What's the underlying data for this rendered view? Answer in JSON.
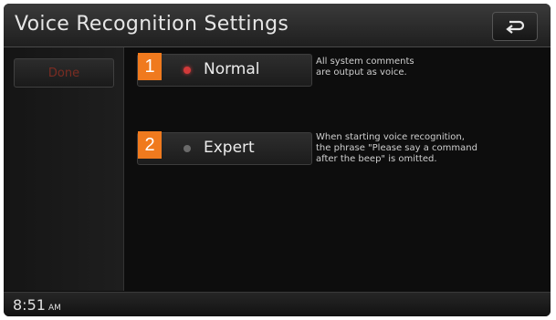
{
  "title": "Voice Recognition Settings",
  "back_icon": "back-arrow-icon",
  "sidebar": {
    "done_label": "Done"
  },
  "options": [
    {
      "badge": "1",
      "label": "Normal",
      "selected": true,
      "description_line1": "All system comments",
      "description_line2": "are output as voice."
    },
    {
      "badge": "2",
      "label": "Expert",
      "selected": false,
      "description_line1": "When starting voice recognition,",
      "description_line2": "the phrase \"Please say a command",
      "description_line3": "after the beep\" is omitted."
    }
  ],
  "status": {
    "time": "8:51",
    "ampm": "AM"
  },
  "colors": {
    "accent_badge": "#f07a1e",
    "radio_selected": "#d23a3a",
    "radio_unselected": "#6a6a6a",
    "done_text": "#7a2c22"
  }
}
